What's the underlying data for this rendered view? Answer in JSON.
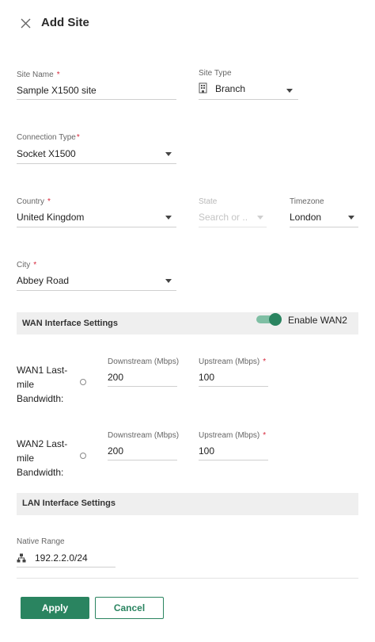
{
  "header": {
    "title": "Add Site",
    "close_icon": "close-icon"
  },
  "site_name": {
    "label": "Site Name",
    "required": "*",
    "value": "Sample X1500 site"
  },
  "site_type": {
    "label": "Site Type",
    "value": "Branch",
    "icon": "building-icon"
  },
  "connection_type": {
    "label": "Connection Type",
    "required": "*",
    "value": "Socket X1500"
  },
  "country": {
    "label": "Country",
    "required": "*",
    "value": "United Kingdom"
  },
  "state": {
    "label": "State",
    "placeholder": "Search or ..."
  },
  "timezone": {
    "label": "Timezone",
    "value": "London"
  },
  "city": {
    "label": "City",
    "required": "*",
    "value": "Abbey Road"
  },
  "wan_section": {
    "title": "WAN Interface Settings",
    "toggle_label": "Enable WAN2",
    "toggle_on": true,
    "accent": "#2a8460"
  },
  "wan1": {
    "label_line1": "WAN1 Last-",
    "label_line2": "mile",
    "label_line3": "Bandwidth:",
    "downstream_label": "Downstream (Mbps)",
    "downstream_value": "200",
    "upstream_label": "Upstream (Mbps)",
    "upstream_required": "*",
    "upstream_value": "100"
  },
  "wan2": {
    "label_line1": "WAN2 Last-",
    "label_line2": "mile",
    "label_line3": "Bandwidth:",
    "downstream_label": "Downstream (Mbps)",
    "downstream_value": "200",
    "upstream_label": "Upstream (Mbps)",
    "upstream_required": "*",
    "upstream_value": "100"
  },
  "lan_section": {
    "title": "LAN Interface Settings"
  },
  "native_range": {
    "label": "Native Range",
    "value": "192.2.2.0/24",
    "icon": "network-icon"
  },
  "footer": {
    "apply_label": "Apply",
    "cancel_label": "Cancel"
  }
}
